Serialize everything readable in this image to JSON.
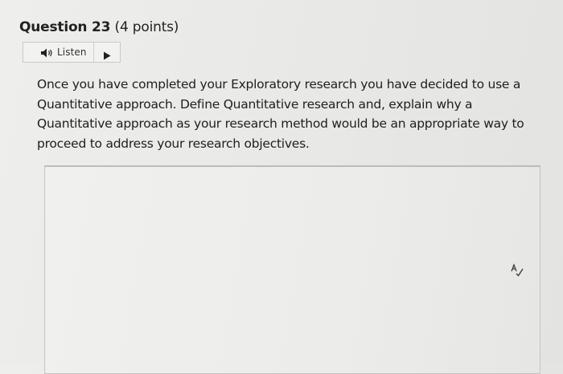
{
  "question": {
    "number_label": "Question 23",
    "points_label": "(4 points)",
    "text": "Once you have completed your Exploratory research you have decided to use a Quantitative approach.  Define Quantitative research and, explain why a Quantitative approach as your research method would be an appropriate way to proceed to address your research objectives."
  },
  "listen": {
    "label": "Listen",
    "icon": "speaker-icon",
    "play_icon": "play-icon"
  },
  "answer_box": {
    "value": "",
    "spellcheck_icon": "spellcheck-icon"
  }
}
